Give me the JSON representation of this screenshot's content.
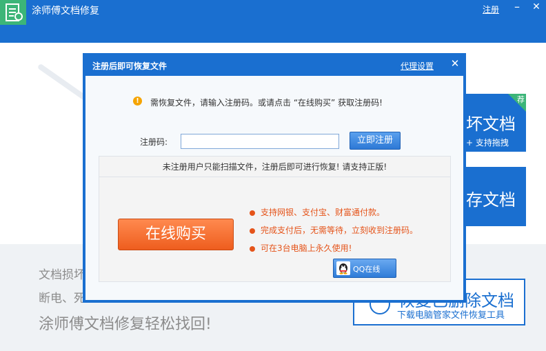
{
  "app": {
    "title": "涂师傅文档修复",
    "register_link": "注册",
    "minimize_glyph": "–",
    "close_glyph": "✕"
  },
  "background": {
    "tile1_title": "坏文档",
    "tile1_sub": "+ 支持拖拽",
    "tile1_badge": "荐",
    "tile2_title": "存文档",
    "line1": "文档损坏",
    "line2": "断电、死",
    "line3": "涂师傅文档修复轻松找回!",
    "tile3_title": "恢复已删除文档",
    "tile3_sub": "下载电脑管家文件恢复工具"
  },
  "dialog": {
    "title": "注册后即可恢复文件",
    "proxy_link": "代理设置",
    "close_glyph": "✕",
    "notice_icon": "!",
    "notice": "需恢复文件，请输入注册码。或请点击 “在线购买” 获取注册码!",
    "code_label": "注册码:",
    "code_value": "",
    "code_placeholder": "",
    "register_button": "立即注册",
    "unregistered_notice": "未注册用户只能扫描文件，注册后即可进行恢复! 请支持正版!",
    "buy_button": "在线购买",
    "features": [
      "支持网银、支付宝、财富通付款。",
      "完成支付后，无需等待，立刻收到注册码。",
      "可在3台电脑上永久使用!"
    ],
    "qq_button": "QQ在线"
  },
  "colors": {
    "brand_blue": "#1a6fd0",
    "accent_orange": "#e5541a",
    "icon_green": "#3cb578",
    "warning": "#f5a400"
  },
  "icons": {
    "app": "document-repair-icon",
    "warning": "warning-icon",
    "bullet": "bullet-dot-icon",
    "qq": "qq-penguin-icon",
    "recover": "pen-icon"
  }
}
